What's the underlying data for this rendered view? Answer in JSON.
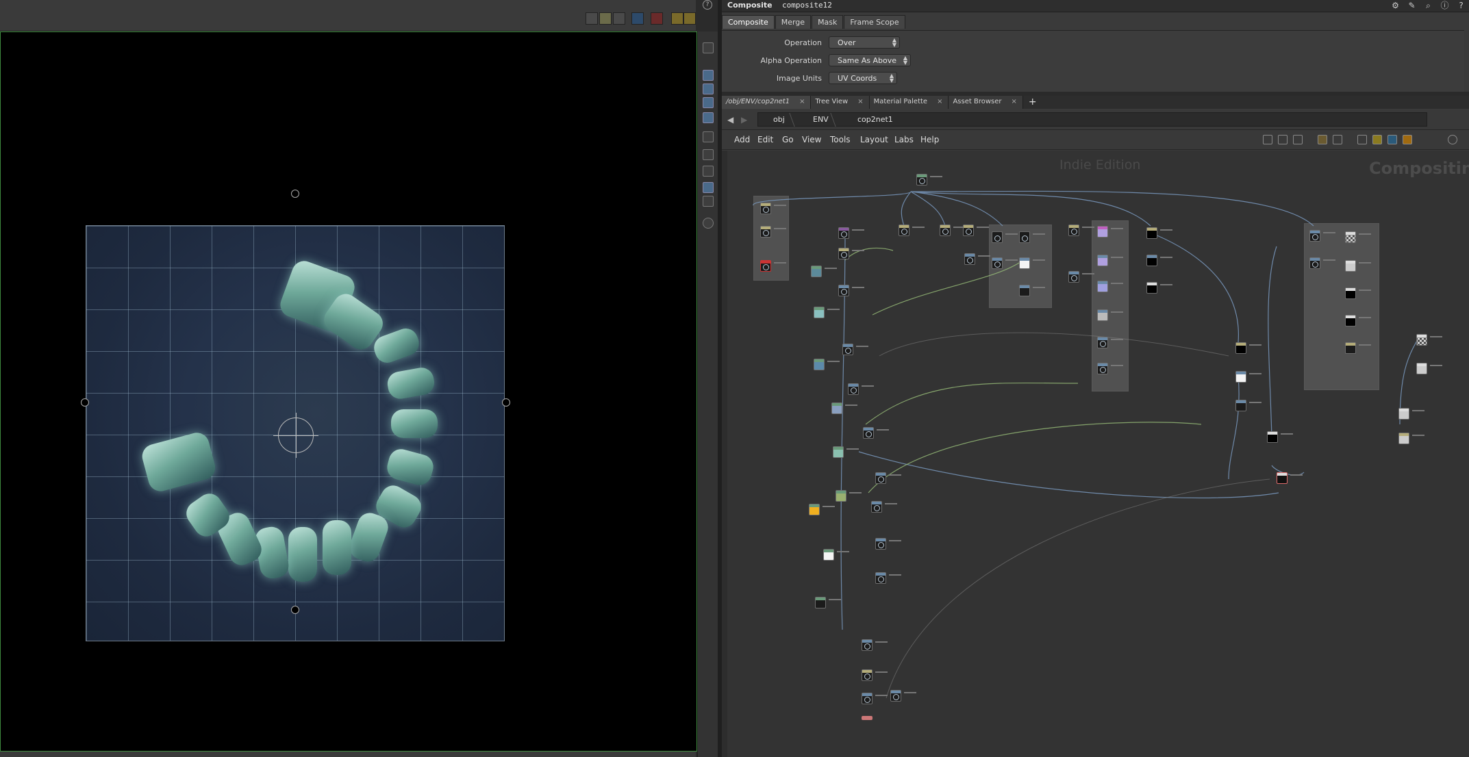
{
  "viewer": {
    "help_icon": "?",
    "toolbar_icons": [
      "display-options-icon",
      "channel-icon",
      "snapshot-icon",
      "camera-icon",
      "magnet-icon",
      "guide-icon",
      "grid-icon",
      "plus-icon"
    ],
    "side_tools": [
      "pointer-icon",
      "view-icon",
      "transform-icon",
      "select-icon",
      "crop-icon",
      "wire-icon",
      "box-icon",
      "region-icon",
      "frame-icon",
      "zoom-icon"
    ]
  },
  "params": {
    "node_type": "Composite",
    "node_name": "composite12",
    "header_icons": [
      "gear-icon",
      "brush-icon",
      "search-icon",
      "info-icon",
      "help-icon"
    ],
    "tabs": [
      "Composite",
      "Merge",
      "Mask",
      "Frame Scope"
    ],
    "rows": [
      {
        "label": "Operation",
        "value": "Over"
      },
      {
        "label": "Alpha Operation",
        "value": "Same As Above"
      },
      {
        "label": "Image Units",
        "value": "UV Coords"
      }
    ]
  },
  "network": {
    "tabs": [
      {
        "label": "/obj/ENV/cop2net1",
        "close": "×"
      },
      {
        "label": "Tree View",
        "close": "×"
      },
      {
        "label": "Material Palette",
        "close": "×"
      },
      {
        "label": "Asset Browser",
        "close": "×"
      }
    ],
    "add_tab": "+",
    "path": [
      "obj",
      "ENV",
      "cop2net1"
    ],
    "menu": [
      "Add",
      "Edit",
      "Go",
      "View",
      "Tools",
      "Layout",
      "Labs",
      "Help"
    ],
    "watermark": "Indie Edition",
    "context": "Compositing"
  }
}
